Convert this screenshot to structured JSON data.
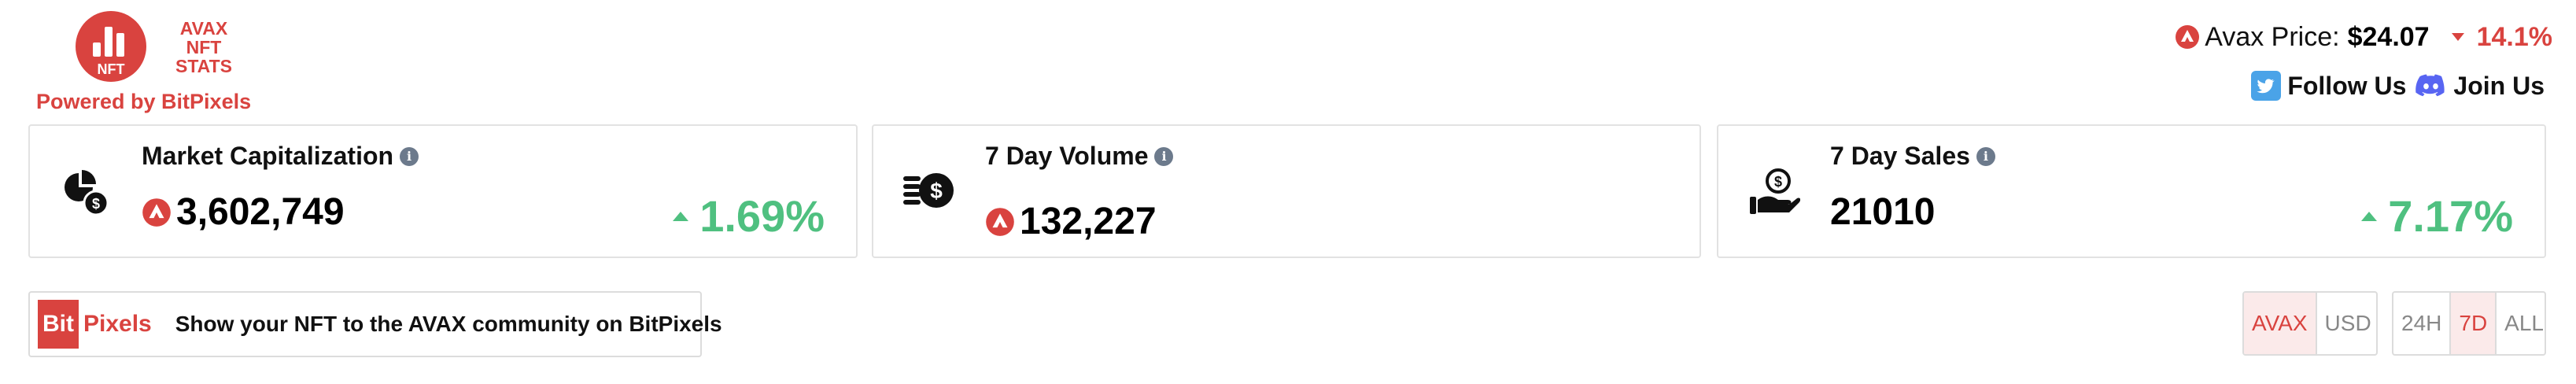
{
  "logo": {
    "line1": "AVAX",
    "line2": "NFT",
    "line3": "STATS",
    "badge": "NFT"
  },
  "powered_by": "Powered by BitPixels",
  "price": {
    "label": "Avax Price:",
    "value": "$24.07",
    "change": "14.1%"
  },
  "social": {
    "follow": "Follow Us",
    "join": "Join Us"
  },
  "cards": [
    {
      "title": "Market Capitalization",
      "value": "3,602,749",
      "change": "1.69%"
    },
    {
      "title": "7 Day Volume",
      "value": "132,227"
    },
    {
      "title": "7 Day Sales",
      "value": "21010",
      "change": "7.17%"
    }
  ],
  "promo": {
    "bit": "Bit",
    "pixels": "Pixels",
    "text": "Show your NFT to the AVAX community on BitPixels"
  },
  "currency_toggle": {
    "avax": "AVAX",
    "usd": "USD",
    "selected": "AVAX"
  },
  "period_toggle": {
    "h24": "24H",
    "d7": "7D",
    "all": "ALL",
    "selected": "7D"
  },
  "colors": {
    "brand": "#d9433f",
    "positive": "#4fc080",
    "info": "#6c7a8c",
    "twitter": "#4aa3e8",
    "discord": "#5865f2"
  }
}
